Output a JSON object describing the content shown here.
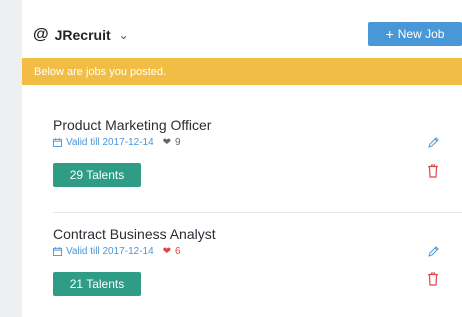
{
  "header": {
    "app_name": "JRecruit",
    "new_job_label": "New Job"
  },
  "notice": "Below are jobs you posted.",
  "jobs": [
    {
      "title": "Product Marketing Officer",
      "valid_label": "Valid till 2017-12-14",
      "likes": "9",
      "heart_color": "#666666",
      "talents_label": "29 Talents"
    },
    {
      "title": "Contract Business Analyst",
      "valid_label": "Valid till 2017-12-14",
      "likes": "6",
      "heart_color": "#e04545",
      "talents_label": "21 Talents"
    }
  ],
  "colors": {
    "primary": "#4a97d8",
    "warning": "#f1bd45",
    "success": "#2f9c86",
    "danger": "#e04545"
  },
  "icons": [
    "at-sign-icon",
    "chevron-down-icon",
    "plus-icon",
    "calendar-icon",
    "heart-icon",
    "pencil-icon",
    "trash-icon"
  ]
}
